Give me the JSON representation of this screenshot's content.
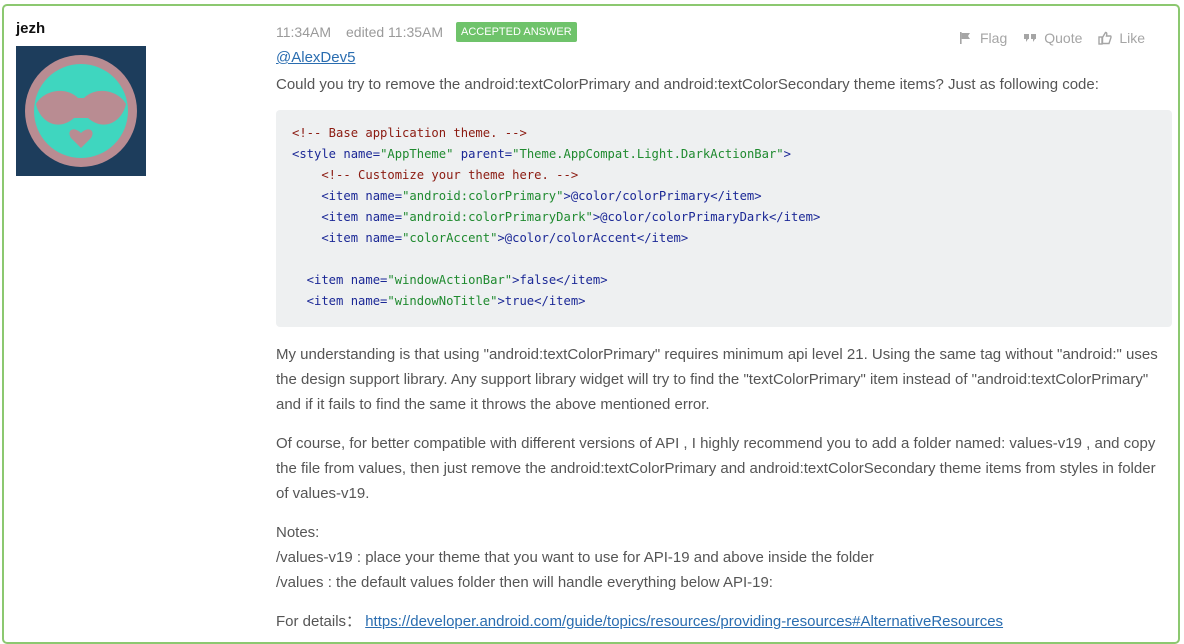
{
  "post": {
    "username": "jezh",
    "time": "11:34AM",
    "edited": "edited 11:35AM",
    "badge": "ACCEPTED ANSWER",
    "actions": {
      "flag": "Flag",
      "quote": "Quote",
      "like": "Like"
    },
    "mention": "@AlexDev5",
    "intro": "Could you try to remove the android:textColorPrimary and android:textColorSecondary theme items? Just as following code:",
    "code": [
      "<!-- Base application theme. -->",
      "<style name=\"AppTheme\" parent=\"Theme.AppCompat.Light.DarkActionBar\">",
      "    <!-- Customize your theme here. -->",
      "    <item name=\"android:colorPrimary\">@color/colorPrimary</item>",
      "    <item name=\"android:colorPrimaryDark\">@color/colorPrimaryDark</item>",
      "    <item name=\"colorAccent\">@color/colorAccent</item>",
      "",
      "  <item name=\"windowActionBar\">false</item>",
      "  <item name=\"windowNoTitle\">true</item>"
    ],
    "paragraph1": "My understanding is that using \"android:textColorPrimary\" requires minimum api level 21. Using the same tag without \"android:\" uses the design support library. Any support library widget will try to find the \"textColorPrimary\" item instead of \"android:textColorPrimary\" and if it fails to find the same it throws the above mentioned error.",
    "paragraph2": "Of course, for better compatible with different versions of API , I highly recommend you to add a folder named: values-v19 , and copy the file from values, then just remove the android:textColorPrimary and android:textColorSecondary theme items from styles in folder of values-v19.",
    "notes_title": "Notes:",
    "note1": "/values-v19 : place your theme that you want to use for API-19 and above inside the folder",
    "note2": "/values : the default values folder then will handle everything below API-19:",
    "details_label": "For details：",
    "details_link": "https://developer.android.com/guide/topics/resources/providing-resources#AlternativeResources"
  },
  "colors": {
    "border": "#8cc870",
    "badge": "#6fc36b",
    "link": "#2a6db0",
    "code_bg": "#eef0f1",
    "avatar_bg": "#1d3d5c",
    "avatar_face": "#3fd6bf",
    "avatar_ring": "#b98c92"
  }
}
